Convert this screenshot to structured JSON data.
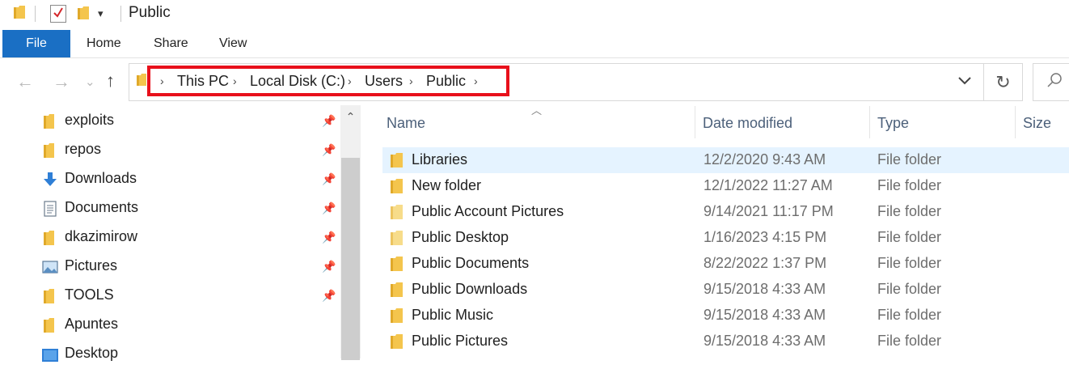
{
  "title_bar": {
    "title": "Public",
    "quick_access": [
      "folder-icon",
      "properties-checkbox-icon",
      "new-folder-icon",
      "customize-dropdown-icon"
    ]
  },
  "ribbon": {
    "file_tab": "File",
    "tabs": [
      "Home",
      "Share",
      "View"
    ],
    "file_tab_color": "#1a6fc4"
  },
  "navigation": {
    "back": "←",
    "forward": "→",
    "recent": "⌄",
    "up": "↑",
    "refresh": "↻"
  },
  "address_bar": {
    "breadcrumbs": [
      "This PC",
      "Local Disk (C:)",
      "Users",
      "Public"
    ],
    "separator": "›",
    "highlight_color": "#e8101b"
  },
  "sidebar": {
    "items": [
      {
        "label": "exploits",
        "icon": "folder-icon",
        "pinned": true
      },
      {
        "label": "repos",
        "icon": "folder-icon",
        "pinned": true
      },
      {
        "label": "Downloads",
        "icon": "download-arrow-icon",
        "pinned": true
      },
      {
        "label": "Documents",
        "icon": "documents-icon",
        "pinned": true
      },
      {
        "label": "dkazimirow",
        "icon": "folder-icon",
        "pinned": true
      },
      {
        "label": "Pictures",
        "icon": "pictures-icon",
        "pinned": true
      },
      {
        "label": "TOOLS",
        "icon": "folder-icon",
        "pinned": true
      },
      {
        "label": "Apuntes",
        "icon": "folder-icon",
        "pinned": false
      },
      {
        "label": "Desktop",
        "icon": "desktop-icon",
        "pinned": false
      }
    ]
  },
  "file_list": {
    "columns": {
      "name": "Name",
      "date": "Date modified",
      "type": "Type",
      "size": "Size"
    },
    "rows": [
      {
        "name": "Libraries",
        "date": "12/2/2020 9:43 AM",
        "type": "File folder",
        "selected": true
      },
      {
        "name": "New folder",
        "date": "12/1/2022 11:27 AM",
        "type": "File folder",
        "selected": false
      },
      {
        "name": "Public Account Pictures",
        "date": "9/14/2021 11:17 PM",
        "type": "File folder",
        "selected": false
      },
      {
        "name": "Public Desktop",
        "date": "1/16/2023 4:15 PM",
        "type": "File folder",
        "selected": false
      },
      {
        "name": "Public Documents",
        "date": "8/22/2022 1:37 PM",
        "type": "File folder",
        "selected": false
      },
      {
        "name": "Public Downloads",
        "date": "9/15/2018 4:33 AM",
        "type": "File folder",
        "selected": false
      },
      {
        "name": "Public Music",
        "date": "9/15/2018 4:33 AM",
        "type": "File folder",
        "selected": false
      },
      {
        "name": "Public Pictures",
        "date": "9/15/2018 4:33 AM",
        "type": "File folder",
        "selected": false
      }
    ],
    "selected_row_color": "#e5f3ff",
    "folder_color": "#f4c54d"
  }
}
